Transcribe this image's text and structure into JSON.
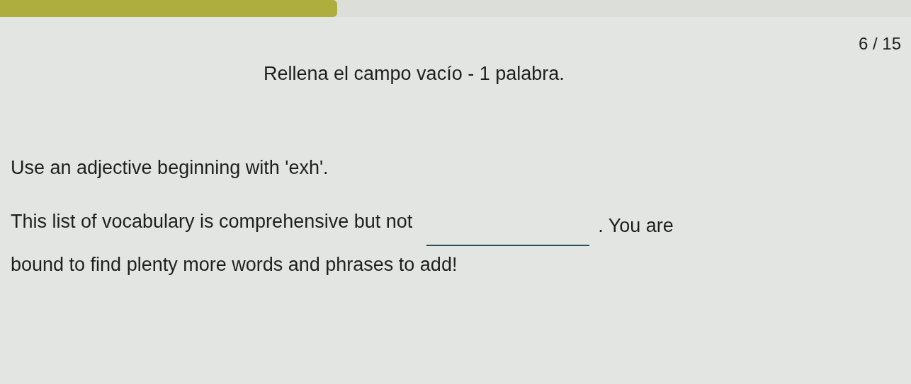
{
  "progress": {
    "level": 0.37
  },
  "counter": "6 / 15",
  "instruction": "Rellena el campo vacío - 1 palabra.",
  "hint": "Use an adjective beginning with 'exh'.",
  "sentence": {
    "before": "This list of vocabulary is comprehensive but not",
    "after": ". You are",
    "continuation": "bound to find plenty more words and phrases to add!"
  }
}
